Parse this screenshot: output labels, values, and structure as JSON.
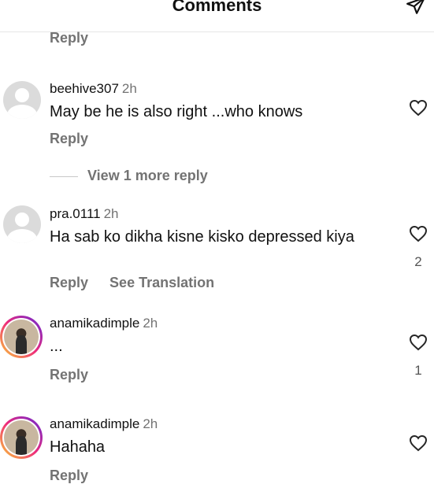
{
  "header": {
    "title": "Comments"
  },
  "top_reply_label": "Reply",
  "comments": [
    {
      "username": "beehive307",
      "time": "2h",
      "text": "May be he is also right ...who knows",
      "actions": [
        "Reply"
      ],
      "likes": ""
    },
    {
      "username": "pra.0111",
      "time": "2h",
      "text": "Ha sab ko dikha kisne kisko depressed kiya",
      "actions": [
        "Reply",
        "See Translation"
      ],
      "likes": "2"
    },
    {
      "username": "anamikadimple",
      "time": "2h",
      "text": "...",
      "actions": [
        "Reply"
      ],
      "likes": "1"
    },
    {
      "username": "anamikadimple",
      "time": "2h",
      "text": "Hahaha",
      "actions": [
        "Reply"
      ],
      "likes": ""
    }
  ],
  "view_more_replies": "View 1 more reply",
  "icons": {
    "share": "paper-plane-icon",
    "like": "heart-outline-icon",
    "avatar_default": "default-avatar-icon"
  }
}
